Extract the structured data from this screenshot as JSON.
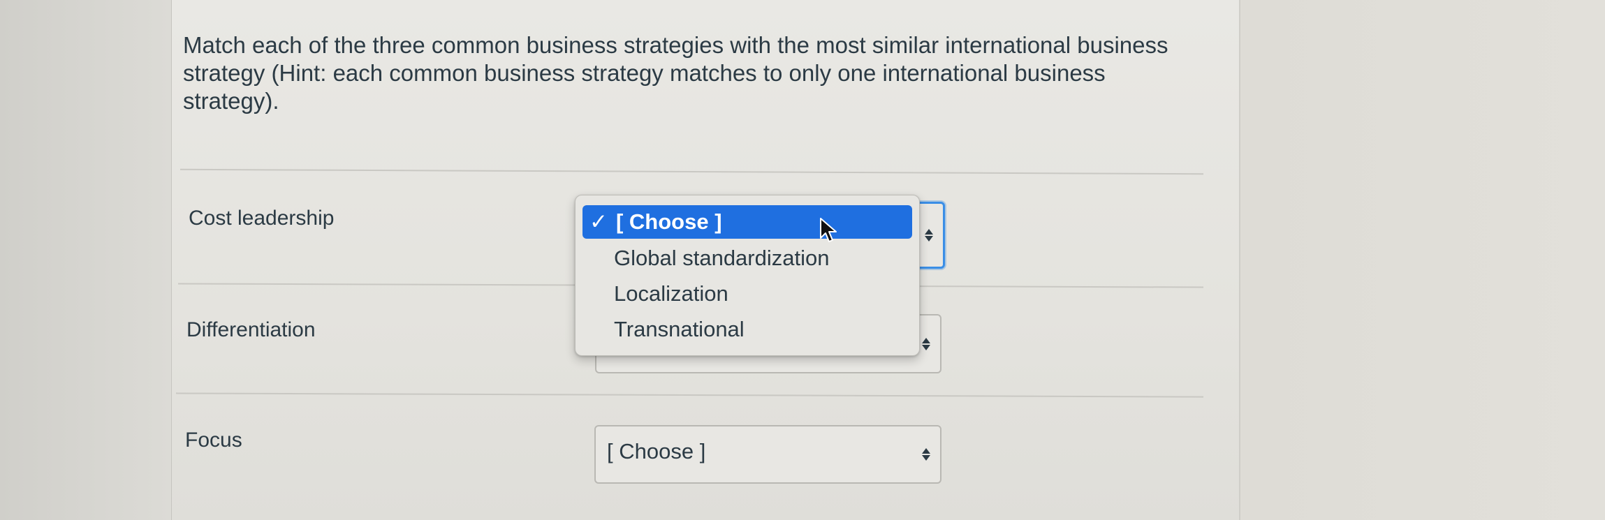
{
  "question": {
    "text": "Match each of the three common business strategies with the most similar international business strategy (Hint: each common business strategy matches to only one international business strategy)."
  },
  "rows": [
    {
      "label": "Cost leadership",
      "selected": "[ Choose ]"
    },
    {
      "label": "Differentiation",
      "selected": ""
    },
    {
      "label": "Focus",
      "selected": "[ Choose ]"
    }
  ],
  "dropdown": {
    "check_mark": "✓",
    "options": [
      "[ Choose ]",
      "Global standardization",
      "Localization",
      "Transnational"
    ],
    "selected_index": 0
  },
  "colors": {
    "highlight": "#1f6fe0",
    "focus_ring": "#3a8ee6",
    "text": "#2b3a44"
  }
}
